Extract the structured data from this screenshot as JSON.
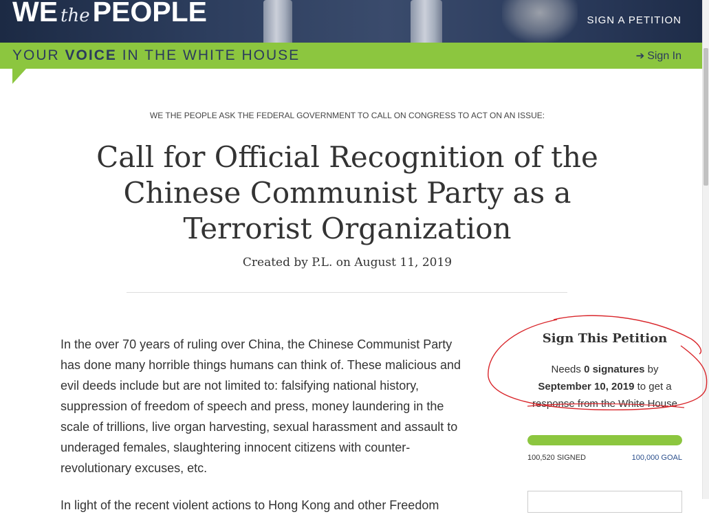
{
  "header": {
    "logo_we": "WE",
    "logo_the": "the",
    "logo_people": "PEOPLE",
    "sign_petition": "SIGN A PETITION"
  },
  "greenbar": {
    "tagline_a": "YOUR ",
    "tagline_b": "VOICE",
    "tagline_c": " IN THE WHITE HOUSE",
    "sign_in": "Sign In"
  },
  "petition": {
    "ask": "WE THE PEOPLE ASK THE FEDERAL GOVERNMENT TO CALL ON CONGRESS TO ACT ON AN ISSUE:",
    "title": "Call for Official Recognition of the Chinese Communist Party as a Terrorist Organization",
    "created_prefix": "Created by ",
    "author": "P.L.",
    "created_on": " on ",
    "date": "August 11, 2019",
    "body_p1": "In the over 70 years of ruling over China, the Chinese Communist Party has done many horrible things humans can think of. These malicious and evil deeds include but are not limited to: falsifying national history, suppression of freedom of speech and press, money laundering in the scale of trillions, live organ harvesting, sexual harassment and assault to underaged females, slaughtering innocent citizens with counter-revolutionary excuses, etc.",
    "body_p2": "In light of the recent violent actions to Hong Kong and other Freedom"
  },
  "sidebar": {
    "heading": "Sign This Petition",
    "needs_a": "Needs ",
    "needs_count": "0 signatures",
    "needs_b": " by",
    "deadline": "September 10, 2019",
    "needs_c": " to get a response from the White House",
    "signed": "100,520 SIGNED",
    "goal": "100,000 GOAL",
    "progress_fraction": 1.0
  },
  "colors": {
    "green": "#8cc63f",
    "navy": "#2b3b5c",
    "annotation_red": "#d9262b"
  }
}
